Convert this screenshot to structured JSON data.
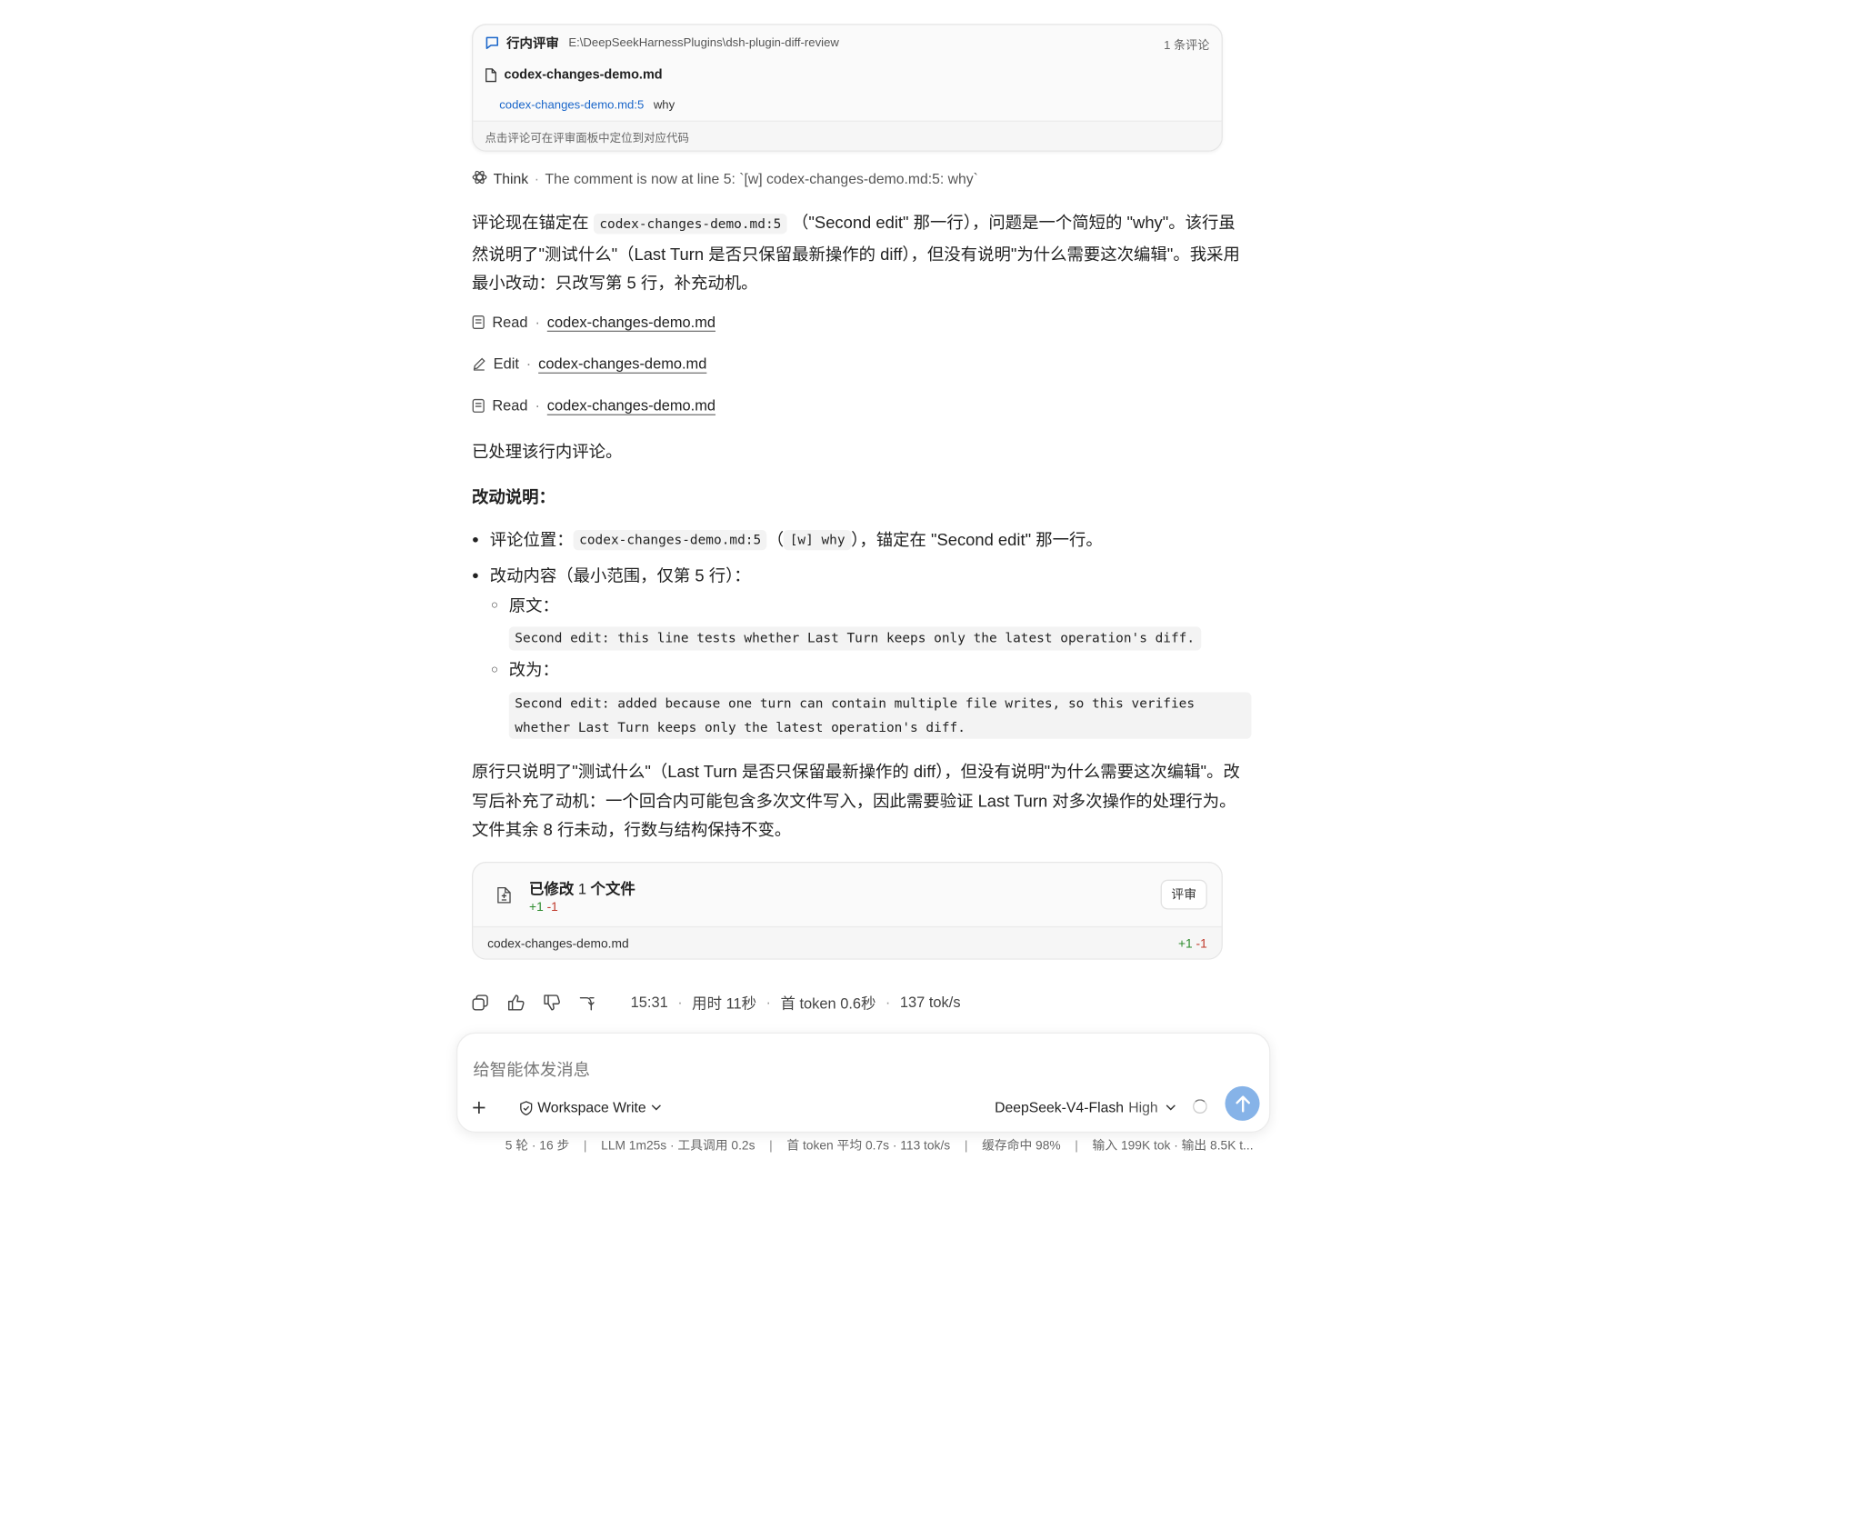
{
  "comment_card": {
    "title": "行内评审",
    "path": "E:\\DeepSeekHarnessPlugins\\dsh-plugin-diff-review",
    "count": "1 条评论",
    "file": "codex-changes-demo.md",
    "comment_location": "codex-changes-demo.md:5",
    "comment_text": "why",
    "footer": "点击评论可在评审面板中定位到对应代码"
  },
  "think": {
    "label": "Think",
    "summary": "The comment is now at line 5: `[w] codex-changes-demo.md:5: why`"
  },
  "paragraph1": {
    "prefix": "评论现在锚定在 ",
    "code": "codex-changes-demo.md:5",
    "suffix": " （\"Second edit\" 那一行），问题是一个简短的 \"why\"。该行虽然说明了\"测试什么\"（Last Turn 是否只保留最新操作的 diff），但没有说明\"为什么需要这次编辑\"。我采用最小改动：只改写第 5 行，补充动机。"
  },
  "tools": [
    {
      "action": "Read",
      "file": "codex-changes-demo.md",
      "icon": "file-icon"
    },
    {
      "action": "Edit",
      "file": "codex-changes-demo.md",
      "icon": "pencil-icon"
    },
    {
      "action": "Read",
      "file": "codex-changes-demo.md",
      "icon": "file-icon"
    }
  ],
  "processed": "已处理该行内评论。",
  "changes_title": "改动说明：",
  "bullets": {
    "location_label": "评论位置：",
    "location_code": "codex-changes-demo.md:5",
    "location_paren_open": "（",
    "location_tag": "[w] why",
    "location_suffix": "），锚定在 \"Second edit\" 那一行。",
    "content_label": "改动内容（最小范围，仅第 5 行）：",
    "original_label": "原文：",
    "original_code": "Second edit: this line tests whether Last Turn keeps only the latest operation's diff.",
    "changed_label": "改为：",
    "changed_code_line1": "Second edit: added because one turn can contain multiple file writes, so this verifies",
    "changed_code_line2": "whether Last Turn keeps only the latest operation's diff."
  },
  "paragraph2": "原行只说明了\"测试什么\"（Last Turn 是否只保留最新操作的 diff），但没有说明\"为什么需要这次编辑\"。改写后补充了动机：一个回合内可能包含多次文件写入，因此需要验证 Last Turn 对多次操作的处理行为。文件其余 8 行未动，行数与结构保持不变。",
  "files_card": {
    "title_prefix": "已修改 ",
    "title_count": "1",
    "title_suffix": " 个文件",
    "added": "+1",
    "removed": "-1",
    "review_button": "评审",
    "file_name": "codex-changes-demo.md",
    "file_added": "+1",
    "file_removed": "-1"
  },
  "message_meta": {
    "time": "15:31",
    "duration": "用时 11秒",
    "first_token": "首 token 0.6秒",
    "speed": "137 tok/s"
  },
  "composer": {
    "placeholder": "给智能体发消息",
    "mode": "Workspace Write",
    "model": "DeepSeek-V4-Flash",
    "level": "High"
  },
  "status_bar": {
    "rounds": "5 轮 · 16 步",
    "llm": "LLM 1m25s · 工具调用 0.2s",
    "token_avg": "首 token 平均 0.7s · 113 tok/s",
    "cache": "缓存命中 98%",
    "io": "输入 199K tok · 输出 8.5K t..."
  },
  "colors": {
    "accent": "#1a66c9",
    "send_button": "#86b3e8",
    "added": "#2c8a2c",
    "removed": "#c0392b"
  }
}
